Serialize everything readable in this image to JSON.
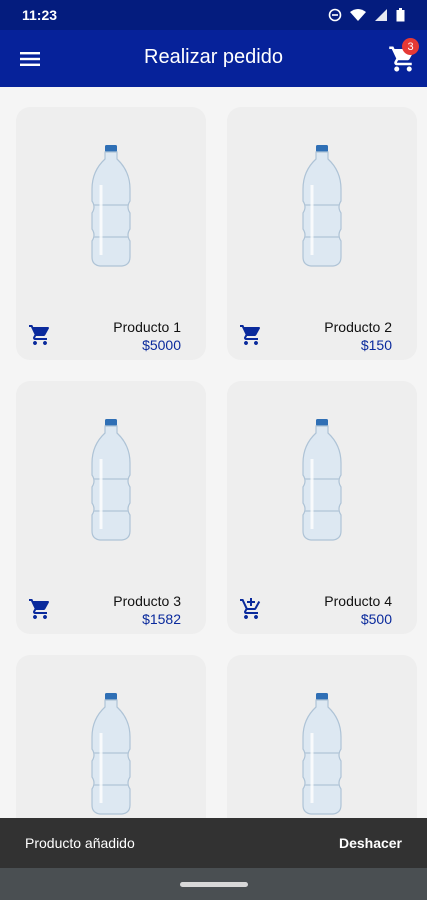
{
  "status": {
    "time": "11:23",
    "icons": [
      "do-not-disturb-icon",
      "wifi-icon",
      "signal-icon",
      "battery-icon"
    ]
  },
  "appbar": {
    "title": "Realizar pedido",
    "cart_count": "3",
    "background": "#06229a",
    "status_background": "#041c7e"
  },
  "products": [
    {
      "name": "Producto 1",
      "price": "$5000",
      "icon": "cart-icon"
    },
    {
      "name": "Producto 2",
      "price": "$150",
      "icon": "cart-icon"
    },
    {
      "name": "Producto 3",
      "price": "$1582",
      "icon": "cart-icon"
    },
    {
      "name": "Producto 4",
      "price": "$500",
      "icon": "add-to-cart-icon"
    },
    {
      "name": "",
      "price": "",
      "icon": ""
    },
    {
      "name": "",
      "price": "",
      "icon": ""
    }
  ],
  "snackbar": {
    "message": "Producto añadido",
    "action": "Deshacer"
  },
  "colors": {
    "accent": "#0a2a9c",
    "badge": "#e53935",
    "card": "#eeeeee"
  }
}
